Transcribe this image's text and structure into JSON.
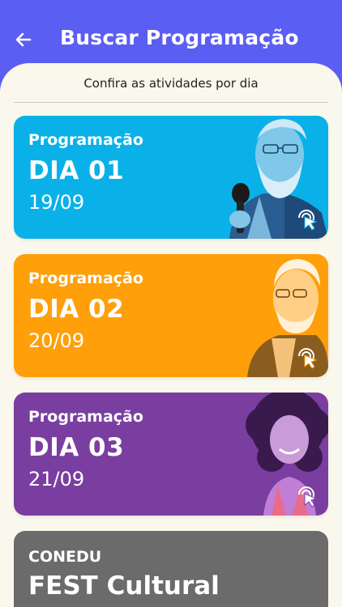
{
  "header": {
    "title": "Buscar Programação",
    "back_icon": "arrow-left-icon",
    "background": "#5b5ef3"
  },
  "subtitle": "Confira as atividades por dia",
  "cards": [
    {
      "label": "Programação",
      "day": "DIA 01",
      "date": "19/09",
      "color": "#0ab1e8",
      "icon": "click-pointer-icon"
    },
    {
      "label": "Programação",
      "day": "DIA 02",
      "date": "20/09",
      "color": "#ff9f0a",
      "icon": "click-pointer-icon"
    },
    {
      "label": "Programação",
      "day": "DIA 03",
      "date": "21/09",
      "color": "#7a3ea1",
      "icon": "click-pointer-icon"
    }
  ],
  "fest_card": {
    "label": "CONEDU",
    "title": "FEST Cultural",
    "color": "#6b6b6b"
  }
}
